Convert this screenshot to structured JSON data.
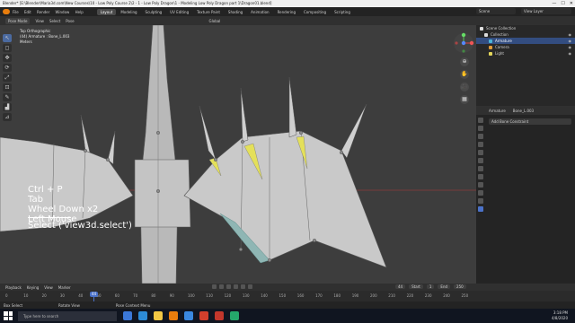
{
  "window": {
    "title": "Blender* [E:\\Blender\\Maria3d.com\\New Courses\\10 - Low Poly Course 2\\2 - 1 - Low Poly Dragon\\1 - Modeling Low Poly Dragon part 1\\Dragon01.blend]",
    "controls": [
      "—",
      "☐",
      "✕"
    ]
  },
  "menu": [
    "File",
    "Edit",
    "Render",
    "Window",
    "Help"
  ],
  "workspace_tabs": [
    "Layout",
    "Modeling",
    "Sculpting",
    "UV Editing",
    "Texture Paint",
    "Shading",
    "Animation",
    "Rendering",
    "Compositing",
    "Scripting"
  ],
  "active_tab": "Layout",
  "scene": "Scene",
  "view_layer": "View Layer",
  "viewport_header": {
    "mode": "Pose Mode",
    "items": [
      "View",
      "Select",
      "Pose"
    ],
    "transform": "Global"
  },
  "viewport_info": {
    "line1": "Top Orthographic",
    "line2": "(44) Armature : Bone_L.003",
    "line3": "Meters"
  },
  "tools": [
    "↖",
    "◻",
    "✥",
    "⟳",
    "⤢",
    "⊡",
    "✎",
    "▟",
    "⊿"
  ],
  "nav_buttons": [
    "⊕",
    "✋",
    "🎥",
    "▦"
  ],
  "keystrokes": [
    "Ctrl + P",
    "Tab",
    "Wheel Down x2",
    "Left Mouse"
  ],
  "operator": "Select ('view3d.select')",
  "outliner": {
    "display_mode": "Scene Collection",
    "rows": [
      {
        "label": "Scene Collection",
        "indent": 0,
        "color": "#dddddd",
        "selected": false
      },
      {
        "label": "Collection",
        "indent": 1,
        "color": "#dddddd",
        "selected": false
      },
      {
        "label": "Armature",
        "indent": 2,
        "color": "#4bb4d8",
        "selected": true
      },
      {
        "label": "Camera",
        "indent": 2,
        "color": "#e39c3a",
        "selected": false
      },
      {
        "label": "Light",
        "indent": 2,
        "color": "#e3d65a",
        "selected": false
      }
    ]
  },
  "properties": {
    "object": "Armature",
    "bone": "Bone_L.003",
    "add_constraint": "Add Bone Constraint"
  },
  "timeline": {
    "menus": [
      "Playback",
      "Keying",
      "View",
      "Marker"
    ],
    "current_frame": "44",
    "start_label": "Start",
    "start": "1",
    "end_label": "End",
    "end": "250",
    "ticks": [
      "0",
      "10",
      "20",
      "30",
      "40",
      "50",
      "60",
      "70",
      "80",
      "90",
      "100",
      "110",
      "120",
      "130",
      "140",
      "150",
      "160",
      "170",
      "180",
      "190",
      "200",
      "210",
      "220",
      "230",
      "240",
      "250"
    ]
  },
  "status": [
    "Box Select",
    "Rotate View",
    "Pose Context Menu"
  ],
  "taskbar": {
    "search": "Type here to search",
    "time": "3:18 PM",
    "date": "4/8/2020",
    "apps": [
      "#3b78d8",
      "#2d8bd6",
      "#f2c744",
      "#e87d0d",
      "#3a88e0",
      "#d23f2c",
      "#c2372c",
      "#25a86b"
    ]
  }
}
